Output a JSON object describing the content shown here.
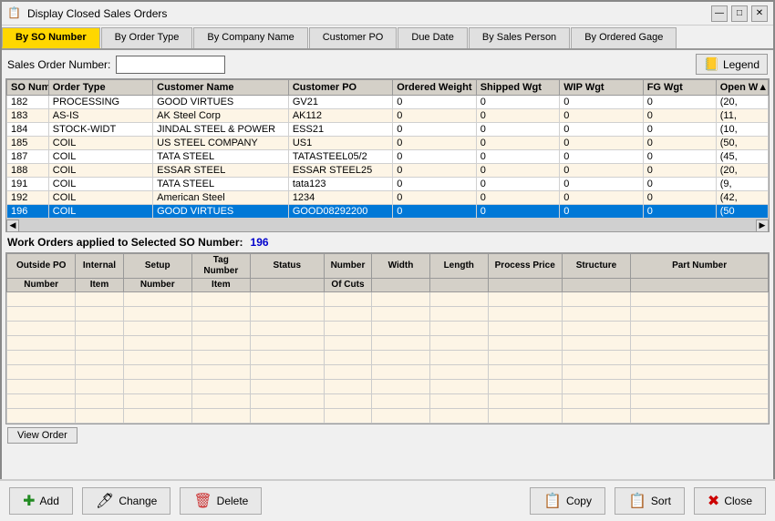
{
  "titlebar": {
    "title": "Display Closed Sales Orders",
    "icon": "📋",
    "min_label": "—",
    "max_label": "□",
    "close_label": "✕"
  },
  "tabs": [
    {
      "id": "by-so-number",
      "label": "By SO Number",
      "active": true
    },
    {
      "id": "by-order-type",
      "label": "By Order Type",
      "active": false
    },
    {
      "id": "by-company-name",
      "label": "By Company Name",
      "active": false
    },
    {
      "id": "by-customer-po",
      "label": "Customer PO",
      "active": false
    },
    {
      "id": "by-due-date",
      "label": "Due Date",
      "active": false
    },
    {
      "id": "by-sales-person",
      "label": "By Sales Person",
      "active": false
    },
    {
      "id": "by-ordered-gage",
      "label": "By Ordered Gage",
      "active": false
    }
  ],
  "search": {
    "label": "Sales Order Number:",
    "placeholder": "",
    "value": ""
  },
  "legend_btn": "Legend",
  "main_table": {
    "columns": [
      "SO Num",
      "Order Type",
      "Customer Name",
      "Customer PO",
      "Ordered Weight",
      "Shipped Wgt",
      "WIP Wgt",
      "FG Wgt",
      "Open W▲"
    ],
    "rows": [
      {
        "so": "182",
        "ot": "PROCESSING",
        "cn": "GOOD VIRTUES",
        "cpo": "GV21",
        "ow": "0",
        "sw": "0",
        "wip": "0",
        "fg": "0",
        "opw": "(20,",
        "selected": false
      },
      {
        "so": "183",
        "ot": "AS-IS",
        "cn": "AK Steel Corp",
        "cpo": "AK112",
        "ow": "0",
        "sw": "0",
        "wip": "0",
        "fg": "0",
        "opw": "(11,",
        "selected": false
      },
      {
        "so": "184",
        "ot": "STOCK-WIDT",
        "cn": "JINDAL STEEL & POWER",
        "cpo": "ESS21",
        "ow": "0",
        "sw": "0",
        "wip": "0",
        "fg": "0",
        "opw": "(10,",
        "selected": false
      },
      {
        "so": "185",
        "ot": "COIL",
        "cn": "US STEEL COMPANY",
        "cpo": "US1",
        "ow": "0",
        "sw": "0",
        "wip": "0",
        "fg": "0",
        "opw": "(50,",
        "selected": false
      },
      {
        "so": "187",
        "ot": "COIL",
        "cn": "TATA STEEL",
        "cpo": "TATASTEEL05/2",
        "ow": "0",
        "sw": "0",
        "wip": "0",
        "fg": "0",
        "opw": "(45,",
        "selected": false
      },
      {
        "so": "188",
        "ot": "COIL",
        "cn": "ESSAR STEEL",
        "cpo": "ESSAR STEEL25",
        "ow": "0",
        "sw": "0",
        "wip": "0",
        "fg": "0",
        "opw": "(20,",
        "selected": false
      },
      {
        "so": "191",
        "ot": "COIL",
        "cn": "TATA STEEL",
        "cpo": "tata123",
        "ow": "0",
        "sw": "0",
        "wip": "0",
        "fg": "0",
        "opw": "(9,",
        "selected": false
      },
      {
        "so": "192",
        "ot": "COIL",
        "cn": "American Steel",
        "cpo": "1234",
        "ow": "0",
        "sw": "0",
        "wip": "0",
        "fg": "0",
        "opw": "(42,",
        "selected": false
      },
      {
        "so": "196",
        "ot": "COIL",
        "cn": "GOOD VIRTUES",
        "cpo": "GOOD08292200",
        "ow": "0",
        "sw": "0",
        "wip": "0",
        "fg": "0",
        "opw": "(50",
        "selected": true
      }
    ]
  },
  "work_orders": {
    "title": "Work Orders applied to Selected SO Number:",
    "so_number": "196",
    "columns_line1": [
      "Outside PO",
      "Internal",
      "Setup",
      "Tag Number",
      "Status",
      "Number",
      "Width",
      "Length",
      "Process Price",
      "Structure",
      "Part Number"
    ],
    "columns_line2": [
      "Number",
      "Item",
      "Number",
      "Item",
      "",
      "Of Cuts",
      "",
      "",
      "",
      "",
      ""
    ],
    "rows": []
  },
  "view_order_btn": "View Order",
  "toolbar": {
    "add_label": "Add",
    "change_label": "Change",
    "delete_label": "Delete",
    "copy_label": "Copy",
    "sort_label": "Sort",
    "close_label": "Close"
  }
}
